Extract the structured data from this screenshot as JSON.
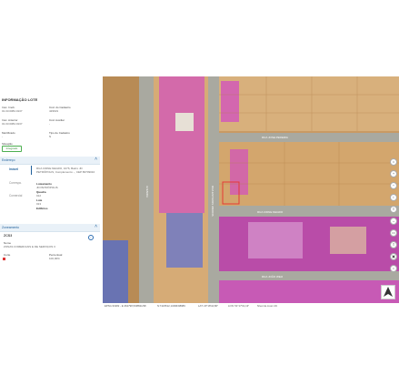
{
  "panel": {
    "title": "INFORMAÇÃO LOTE",
    "fields": [
      {
        "label": "Insc. Imob.",
        "value": "01.03.0084.0137"
      },
      {
        "label": "Cód. do Cadastro",
        "value": "429619"
      },
      {
        "label": "Insc. Anterior",
        "value": "01.03.0084.0137"
      },
      {
        "label": "Cód. Auxiliar",
        "value": "-"
      },
      {
        "label": "Metrificado",
        "value": "-"
      },
      {
        "label": "Tipo de Cadastro",
        "value": "N"
      }
    ],
    "situacao_label": "Situação",
    "situacao_badge": "Integrado",
    "endereco": {
      "title": "Endereço",
      "tabs": [
        "Imóvel",
        "Correspo.",
        "Comercial"
      ],
      "address_line": "RUA CIDNE NEGRO, 1076, Bairro JD PETRÓPOLIS, Complemento: -, CEP 86709010",
      "loteamento_label": "Loteamento",
      "loteamento_value": "JD PETRÓPOLIS",
      "quadra_label": "Quadra",
      "quadra_value": "012",
      "lote_label": "Lote",
      "lote_value": "013",
      "edificios_label": "Edifícios"
    },
    "zoneamento": {
      "title": "Zoneamento",
      "code": "ZCS3",
      "nome_label": "Nome",
      "nome_value": "ZONAS COMERCIAIS E DE SERVIÇOS 3",
      "corte_label": "Corte",
      "percentual_label": "Percentual",
      "percentual_value": "100,00%"
    }
  },
  "map": {
    "street_labels": [
      "RUA JOSE PEREIRA",
      "RUA CIDNE NEGRO",
      "RUA JOÃO WEIJ",
      "AVENIDA",
      "RUA ESTADOS UNIDOS"
    ],
    "tool_icons": [
      "home-icon",
      "zoom-in-icon",
      "zoom-out-icon",
      "info-icon",
      "layers-icon",
      "measure-icon",
      "print-icon",
      "share-icon",
      "lock-icon",
      "pin-icon"
    ]
  },
  "statusbar": {
    "epsg": "EPSG:31982 - E:462798,5/08821/98",
    "n": "N:7423512,13496/98989",
    "lat": "LAT: 23°18'44,86\"",
    "lon": "LON: 51°17'01,13\"",
    "zoom": "Nível de zoom:19"
  },
  "colors": {
    "accent": "#1f5f9a",
    "zone_magenta": "#d24fc0",
    "zone_blue": "#4f6bd2",
    "roof_tan": "#d9b07a",
    "selected": "#e53935"
  }
}
